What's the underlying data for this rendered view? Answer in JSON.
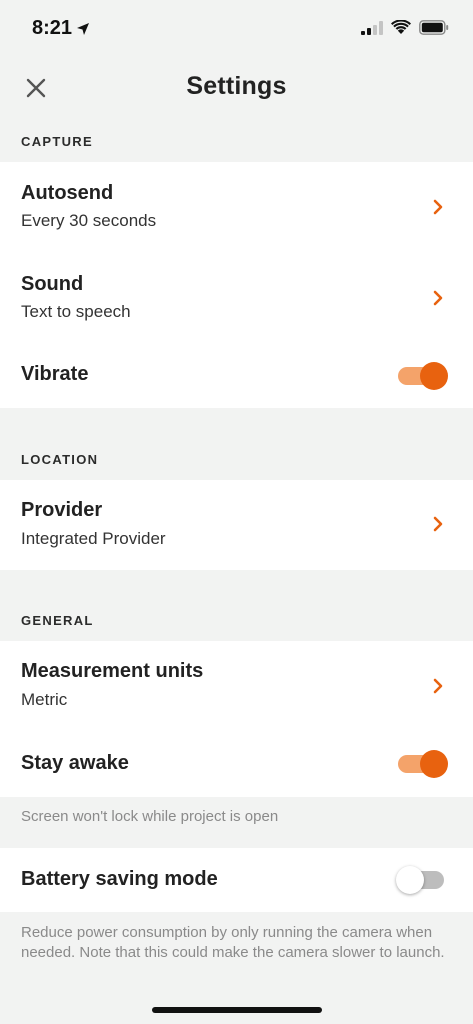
{
  "status_bar": {
    "time": "8:21",
    "location_icon": "location-arrow-icon",
    "signal_icon": "cellular-signal-icon",
    "wifi_icon": "wifi-icon",
    "battery_icon": "battery-icon"
  },
  "header": {
    "title": "Settings",
    "close_icon": "close-icon"
  },
  "colors": {
    "accent": "#e8620f",
    "accent_track": "#f4a36a",
    "background": "#f2f3f2",
    "card": "#ffffff"
  },
  "capture": {
    "header": "CAPTURE",
    "autosend": {
      "title": "Autosend",
      "value": "Every 30 seconds"
    },
    "sound": {
      "title": "Sound",
      "value": "Text to speech"
    },
    "vibrate": {
      "title": "Vibrate",
      "enabled": true
    }
  },
  "location": {
    "header": "LOCATION",
    "provider": {
      "title": "Provider",
      "value": "Integrated Provider"
    }
  },
  "general": {
    "header": "GENERAL",
    "measurement": {
      "title": "Measurement units",
      "value": "Metric"
    },
    "stay_awake": {
      "title": "Stay awake",
      "enabled": true,
      "note": "Screen won't lock while project is open"
    },
    "battery_saving": {
      "title": "Battery saving mode",
      "enabled": false,
      "note": "Reduce power consumption by only running the camera when needed. Note that this could make the camera slower to launch."
    }
  }
}
